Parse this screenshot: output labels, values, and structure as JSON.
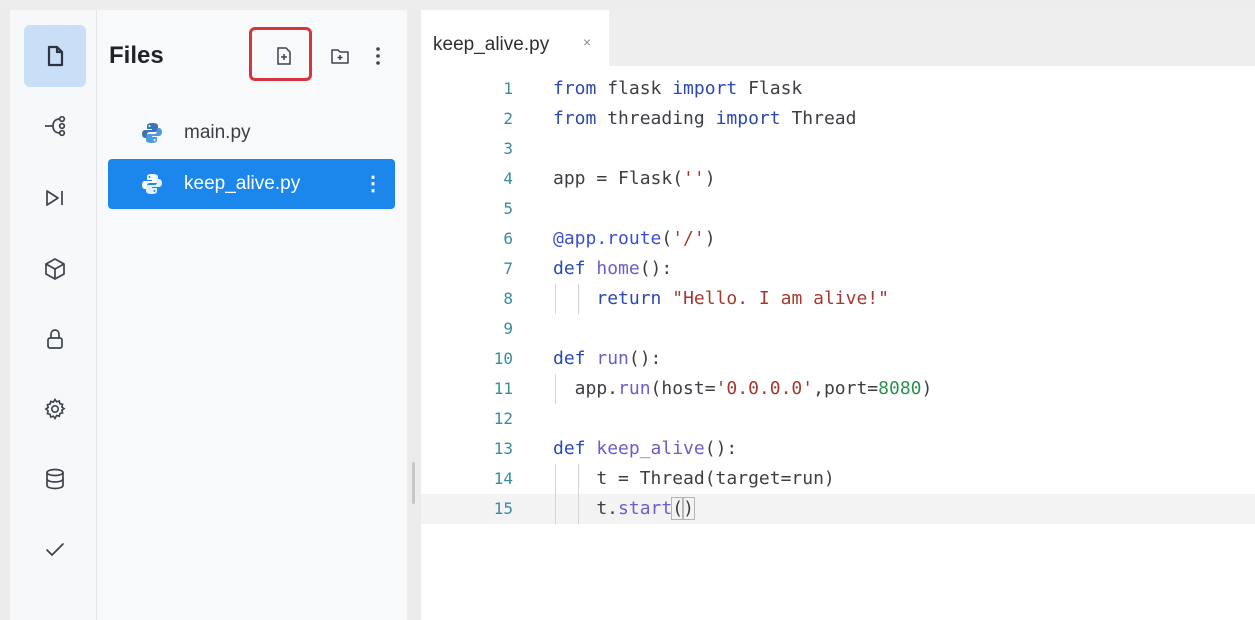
{
  "activity_bar": {
    "items": [
      {
        "icon": "files-icon",
        "active": true
      },
      {
        "icon": "git-branch-icon",
        "active": false
      },
      {
        "icon": "run-step-icon",
        "active": false
      },
      {
        "icon": "package-icon",
        "active": false
      },
      {
        "icon": "lock-icon",
        "active": false
      },
      {
        "icon": "gear-icon",
        "active": false
      },
      {
        "icon": "database-icon",
        "active": false
      },
      {
        "icon": "check-icon",
        "active": false
      }
    ]
  },
  "files_panel": {
    "title": "Files",
    "actions": [
      {
        "icon": "new-file-icon",
        "highlighted": true
      },
      {
        "icon": "new-folder-icon",
        "highlighted": false
      },
      {
        "icon": "more-vertical-icon",
        "highlighted": false
      }
    ],
    "files": [
      {
        "name": "main.py",
        "selected": false
      },
      {
        "name": "keep_alive.py",
        "selected": true
      }
    ],
    "item_menu_glyph": "⋮"
  },
  "editor": {
    "tab": {
      "label": "keep_alive.py",
      "close_glyph": "×"
    },
    "current_line": 15,
    "lines": [
      {
        "num": "1",
        "text": "from flask import Flask"
      },
      {
        "num": "2",
        "text": "from threading import Thread"
      },
      {
        "num": "3",
        "text": ""
      },
      {
        "num": "4",
        "text": "app = Flask('')"
      },
      {
        "num": "5",
        "text": ""
      },
      {
        "num": "6",
        "text": "@app.route('/')"
      },
      {
        "num": "7",
        "text": "def home():"
      },
      {
        "num": "8",
        "text": "    return \"Hello. I am alive!\""
      },
      {
        "num": "9",
        "text": ""
      },
      {
        "num": "10",
        "text": "def run():"
      },
      {
        "num": "11",
        "text": "  app.run(host='0.0.0.0',port=8080)"
      },
      {
        "num": "12",
        "text": ""
      },
      {
        "num": "13",
        "text": "def keep_alive():"
      },
      {
        "num": "14",
        "text": "    t = Thread(target=run)"
      },
      {
        "num": "15",
        "text": "    t.start()"
      }
    ]
  },
  "colors": {
    "accent": "#1b86ec",
    "highlight_box": "#d6353b",
    "active_activity": "#c9def7"
  }
}
